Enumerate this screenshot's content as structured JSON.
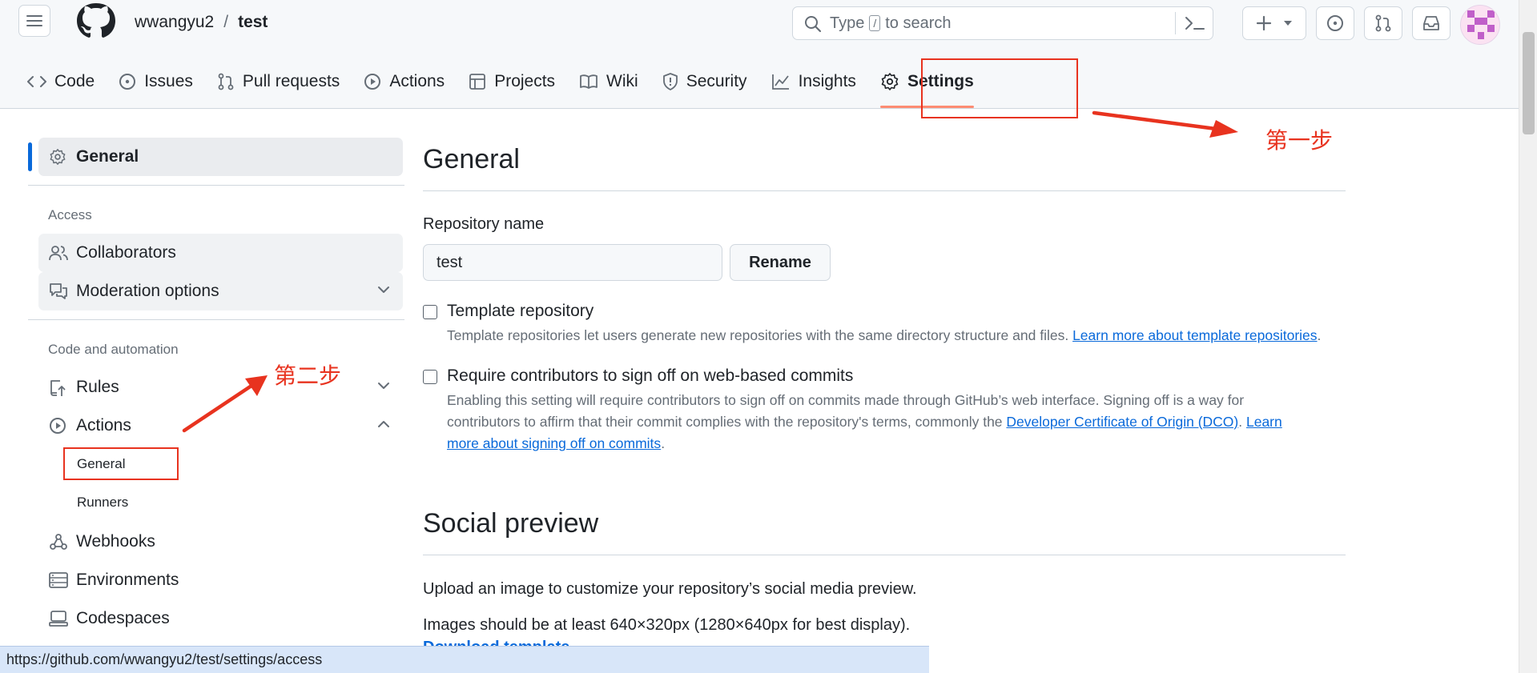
{
  "header": {
    "owner": "wwangyu2",
    "separator": "/",
    "repo": "test",
    "search": {
      "prefix": "Type",
      "key": "/",
      "suffix": "to search"
    }
  },
  "tabs": [
    {
      "label": "Code",
      "icon": "code-icon"
    },
    {
      "label": "Issues",
      "icon": "issue-opened-icon"
    },
    {
      "label": "Pull requests",
      "icon": "git-pull-request-icon"
    },
    {
      "label": "Actions",
      "icon": "play-icon"
    },
    {
      "label": "Projects",
      "icon": "table-icon"
    },
    {
      "label": "Wiki",
      "icon": "book-icon"
    },
    {
      "label": "Security",
      "icon": "shield-icon"
    },
    {
      "label": "Insights",
      "icon": "graph-icon"
    },
    {
      "label": "Settings",
      "icon": "gear-icon",
      "active": true
    }
  ],
  "sidebar": {
    "general": "General",
    "access_heading": "Access",
    "collaborators": "Collaborators",
    "moderation": "Moderation options",
    "code_heading": "Code and automation",
    "rules": "Rules",
    "actions": "Actions",
    "actions_general": "General",
    "actions_runners": "Runners",
    "webhooks": "Webhooks",
    "environments": "Environments",
    "codespaces": "Codespaces"
  },
  "main": {
    "title": "General",
    "repo_name_label": "Repository name",
    "repo_name_value": "test",
    "rename_button": "Rename",
    "template": {
      "title": "Template repository",
      "desc": "Template repositories let users generate new repositories with the same directory structure and files.",
      "link": "Learn more about template repositories",
      "end": "."
    },
    "signoff": {
      "title": "Require contributors to sign off on web-based commits",
      "desc1": "Enabling this setting will require contributors to sign off on commits made through GitHub’s web interface. Signing off is a way for",
      "desc2": "contributors to affirm that their commit complies with the repository's terms, commonly the",
      "link1": "Developer Certificate of Origin (DCO)",
      "mid": ".",
      "link2a": "Learn",
      "link2b": "more about signing off on commits",
      "end": "."
    },
    "social_title": "Social preview",
    "social_p1": "Upload an image to customize your repository’s social media preview.",
    "social_p2": "Images should be at least 640×320px (1280×640px for best display).",
    "social_partial": "Download template"
  },
  "annotations": {
    "step1": "第一步",
    "step2": "第二步"
  },
  "status_url": "https://github.com/wwangyu2/test/settings/access",
  "colors": {
    "accent": "#0969da",
    "annotation_red": "#e8331f",
    "active_tab_underline": "#fd8c73",
    "status_bar": "#d8e6f9"
  }
}
